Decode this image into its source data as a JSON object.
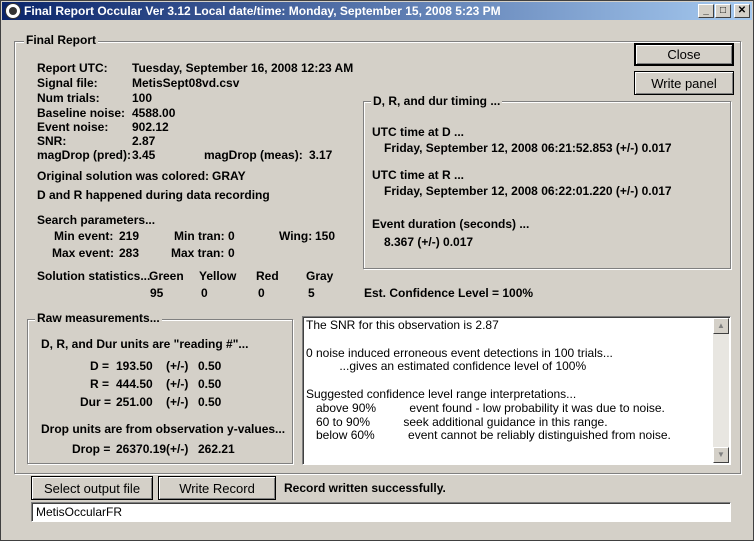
{
  "window": {
    "title": "Final Report Occular Ver 3.12  Local date/time:  Monday, September 15, 2008  5:23 PM",
    "minimize": "_",
    "maximize": "□",
    "close": "✕"
  },
  "report": {
    "group_label": "Final Report",
    "report_utc_label": "Report UTC:",
    "report_utc_value": "Tuesday, September 16, 2008 12:23 AM",
    "signal_file_label": "Signal file:",
    "signal_file_value": "MetisSept08vd.csv",
    "num_trials_label": "Num trials:",
    "num_trials_value": "100",
    "baseline_noise_label": "Baseline noise:",
    "baseline_noise_value": "4588.00",
    "event_noise_label": "Event noise:",
    "event_noise_value": "902.12",
    "snr_label": "SNR:",
    "snr_value": "2.87",
    "magdrop_pred_label": "magDrop (pred):",
    "magdrop_pred_value": "3.45",
    "magdrop_meas_label": "magDrop (meas):",
    "magdrop_meas_value": "3.17",
    "original_colored_label": "Original solution was colored:",
    "original_colored_value": "GRAY",
    "dr_during_recording": "D and R happened during data recording",
    "search_params_label": "Search parameters...",
    "min_event_label": "Min event:",
    "min_event_value": "219",
    "min_tran_label": "Min tran:",
    "min_tran_value": "0",
    "wing_label": "Wing:",
    "wing_value": "150",
    "max_event_label": "Max event:",
    "max_event_value": "283",
    "max_tran_label": "Max tran:",
    "max_tran_value": "0",
    "solution_stats_label": "Solution statistics...",
    "green_label": "Green",
    "green_value": "95",
    "yellow_label": "Yellow",
    "yellow_value": "0",
    "red_label": "Red",
    "red_value": "0",
    "gray_label": "Gray",
    "gray_value": "5",
    "confidence": "Est. Confidence Level = 100%"
  },
  "timing": {
    "group_label": "D, R, and dur timing ...",
    "d_label": "UTC time at D ...",
    "d_value": "Friday, September 12, 2008 06:21:52.853  (+/-)  0.017",
    "r_label": "UTC time at R ...",
    "r_value": "Friday, September 12, 2008 06:22:01.220  (+/-)  0.017",
    "dur_label": "Event duration (seconds) ...",
    "dur_value": "8.367  (+/-)  0.017"
  },
  "raw": {
    "group_label": "Raw measurements...",
    "units_note": "D, R, and Dur units are \"reading #\"...",
    "d_label": "D =",
    "d_value": "193.50",
    "r_label": "R =",
    "r_value": "444.50",
    "dur_label": "Dur =",
    "dur_value": "251.00",
    "pm": "(+/-)",
    "d_err": "0.50",
    "r_err": "0.50",
    "dur_err": "0.50",
    "drop_units_note": "Drop units are from observation y-values...",
    "drop_label": "Drop =",
    "drop_value": "26370.19",
    "drop_err": "262.21"
  },
  "memo": {
    "text": "The SNR for this observation is 2.87\n\n0 noise induced erroneous event detections in 100 trials...\n          ...gives an estimated confidence level of 100%\n\nSuggested confidence level range interpretations...\n   above 90%          event found - low probability it was due to noise.\n   60 to 90%          seek additional guidance in this range.\n   below 60%          event cannot be reliably distinguished from noise."
  },
  "buttons": {
    "close": "Close",
    "write_panel": "Write panel",
    "select_output": "Select output file",
    "write_record": "Write Record"
  },
  "status": "Record written successfully.",
  "output_field_value": "MetisOccularFR"
}
